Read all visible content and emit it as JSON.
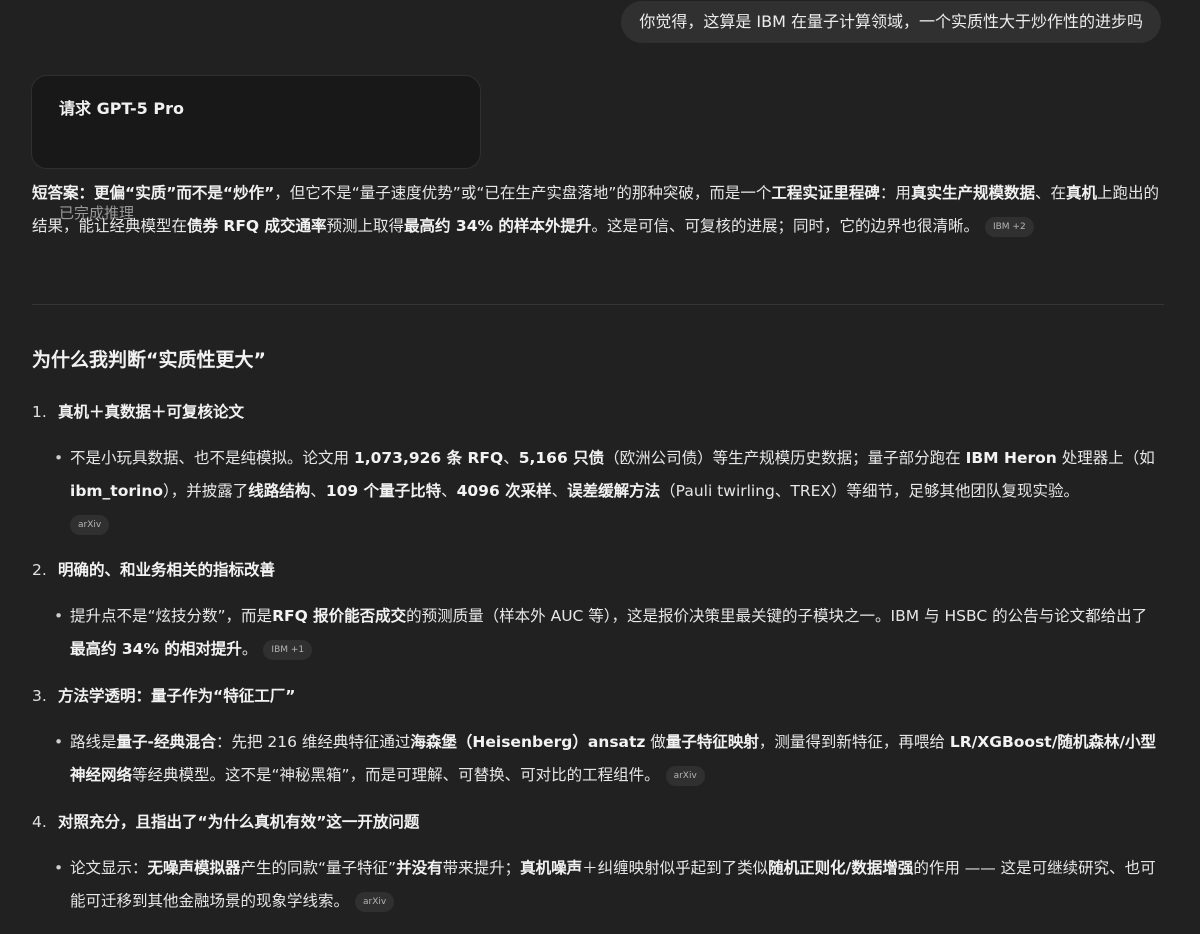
{
  "user_message": "你觉得，这算是 IBM 在量子计算领域，一个实质性大于炒作性的进步吗",
  "request_card": {
    "title": "请求 GPT-5 Pro",
    "status": "已完成推理"
  },
  "short_answer": {
    "t1": "短答案",
    "t2": "：",
    "t3": "更偏“实质”而不是“炒作”",
    "t4": "，但它不是“量子速度优势”或“已在生产实盘落地”的那种突破，而是一个",
    "t5": "工程实证里程碑",
    "t6": "：用",
    "t7": "真实生产规模数据",
    "t8": "、在",
    "t9": "真机",
    "t10": "上跑出的结果，能让经典模型在",
    "t11": "债券 RFQ 成交通率",
    "t12": "预测上取得",
    "t13": "最高约 34% 的样本外提升",
    "t14": "。这是可信、可复核的进展；同时，它的边界也很清晰。",
    "chip": "IBM +2"
  },
  "section_title": "为什么我判断“实质性更大”",
  "items": [
    {
      "num": "1.",
      "title": "真机＋真数据＋可复核论文",
      "b1": "不是小玩具数据、也不是纯模拟。论文用 ",
      "b2": "1,073,926 条 RFQ",
      "b3": "、",
      "b4": "5,166 只债",
      "b5": "（欧洲公司债）等生产规模历史数据；量子部分跑在 ",
      "b6": "IBM Heron",
      "b7": " 处理器上（如 ",
      "b8": "ibm_torino",
      "b9": "），并披露了",
      "b10": "线路结构",
      "b11": "、",
      "b12": "109 个量子比特",
      "b13": "、",
      "b14": "4096 次采样",
      "b15": "、",
      "b16": "误差缓解方法",
      "b17": "（Pauli twirling、TREX）等细节，足够其他团队复现实验。",
      "chip": "arXiv"
    },
    {
      "num": "2.",
      "title": "明确的、和业务相关的指标改善",
      "b1": "提升点不是“炫技分数”，而是",
      "b2": "RFQ 报价能否成交",
      "b3": "的预测质量（样本外 AUC 等），这是报价决策里最关键的子模块之一。IBM 与 HSBC 的公告与论文都给出了",
      "b4": "最高约 34% 的相对提升",
      "b5": "。",
      "chip": "IBM +1"
    },
    {
      "num": "3.",
      "title": "方法学透明：量子作为“特征工厂”",
      "b1": "路线是",
      "b2": "量子-经典混合",
      "b3": "：先把 216 维经典特征通过",
      "b4": "海森堡（Heisenberg）ansatz",
      "b5": " 做",
      "b6": "量子特征映射",
      "b7": "，测量得到新特征，再喂给 ",
      "b8": "LR/XGBoost/随机森林/小型神经网络",
      "b9": "等经典模型。这不是“神秘黑箱”，而是可理解、可替换、可对比的工程组件。",
      "chip": "arXiv"
    },
    {
      "num": "4.",
      "title": "对照充分，且指出了“为什么真机有效”这一开放问题",
      "b1": "论文显示：",
      "b2": "无噪声模拟器",
      "b3": "产生的同款“量子特征”",
      "b4": "并没有",
      "b5": "带来提升；",
      "b6": "真机噪声",
      "b7": "＋纠缠映射似乎起到了类似",
      "b8": "随机正则化/数据增强",
      "b9": "的作用 —— 这是可继续研究、也可能可迁移到其他金融场景的现象学线索。",
      "chip": "arXiv"
    }
  ]
}
